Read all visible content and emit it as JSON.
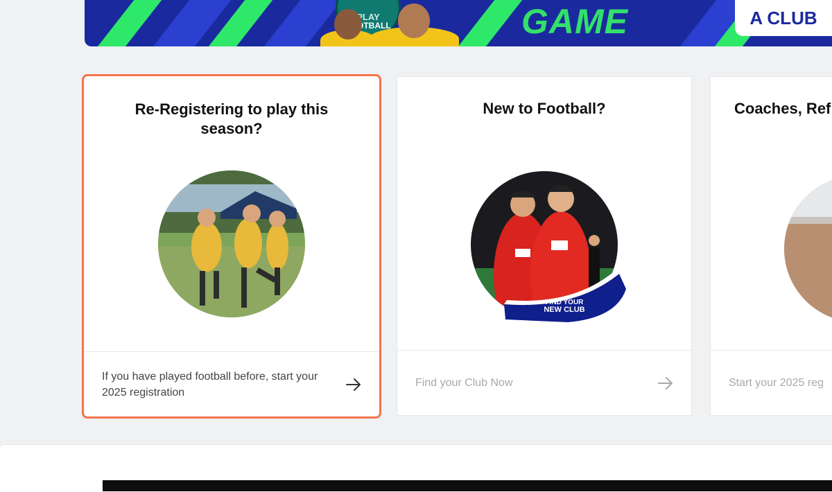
{
  "banner": {
    "badge_line1": "PLAY",
    "badge_line2": "FOOTBALL",
    "headline": "GAME",
    "cta": "A CLUB",
    "colors": {
      "navy": "#1a2a9e",
      "green": "#2ee86a",
      "yellow": "#f2c419"
    }
  },
  "cards": [
    {
      "title": "Re-Registering to play this season?",
      "footer": "If you have played football before, start your 2025 registration",
      "icon": "arrow-right-icon",
      "active": true
    },
    {
      "title": "New to Football?",
      "footer": "Find your Club Now",
      "icon": "arrow-right-icon",
      "photo_caption_line1": "FIND YOUR",
      "photo_caption_line2": "NEW CLUB",
      "active": false
    },
    {
      "title": "Coaches, Ref",
      "footer": "Start your 2025 reg",
      "icon": "arrow-right-icon",
      "active": false
    }
  ],
  "accent": "#f2744b"
}
